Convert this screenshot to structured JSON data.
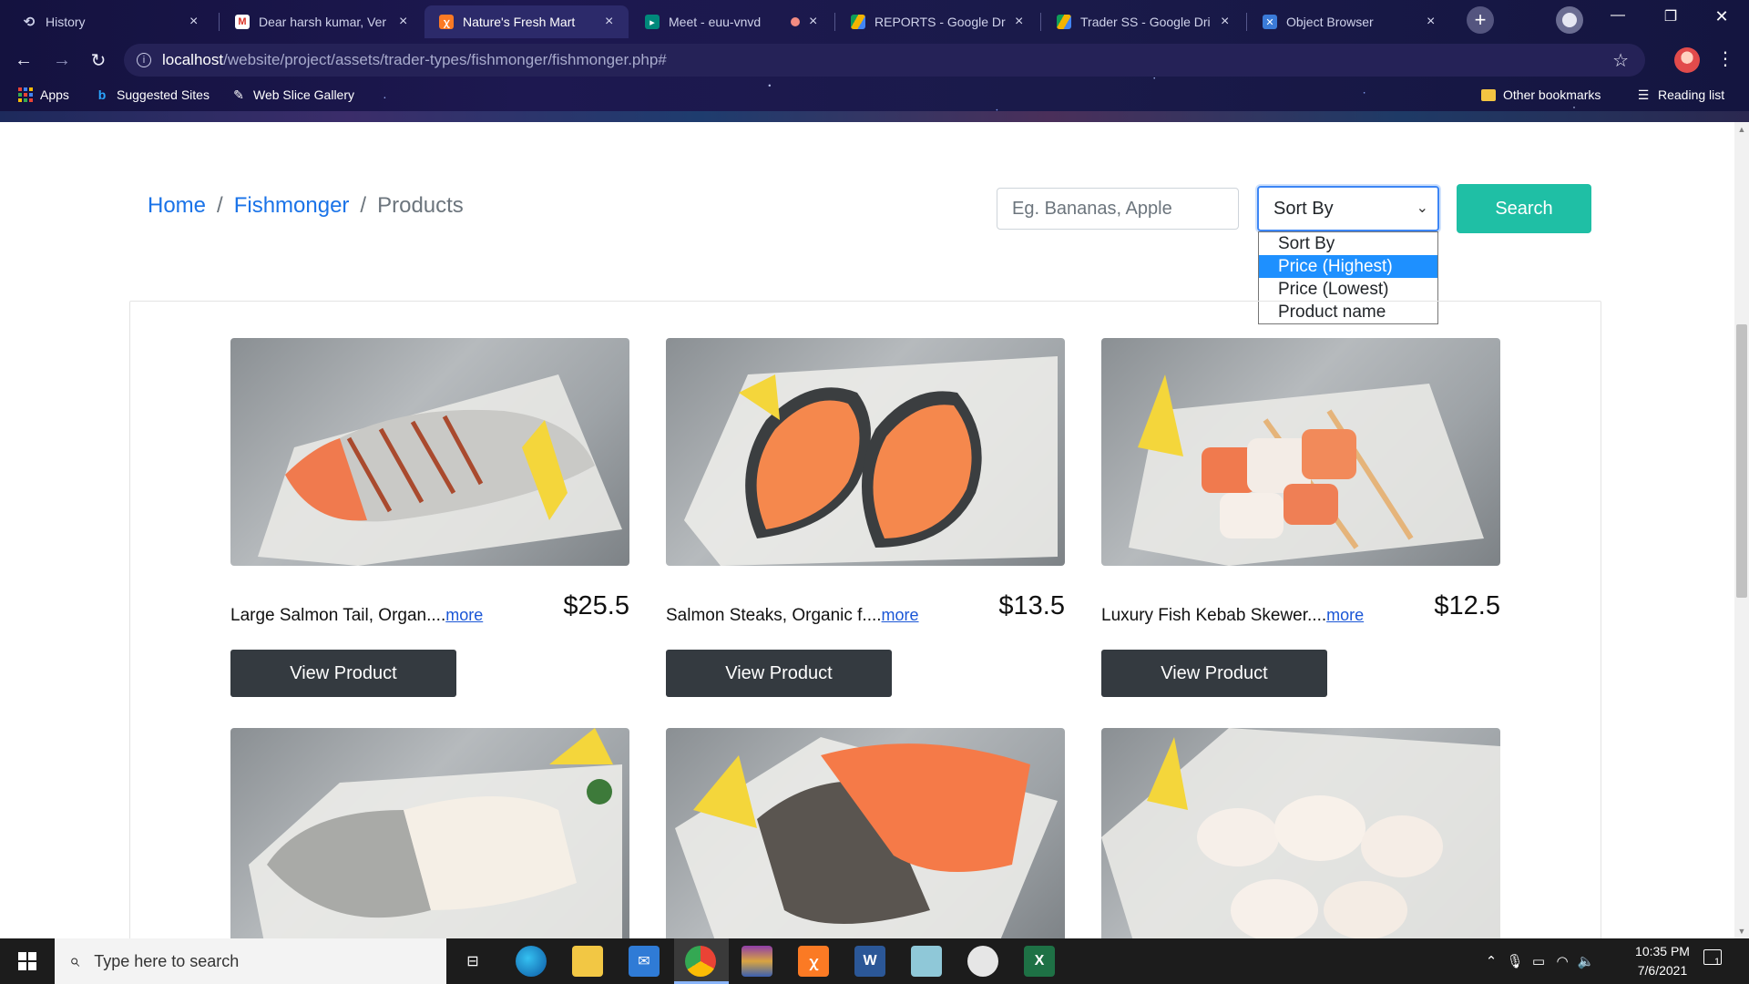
{
  "browser": {
    "tabs": [
      {
        "title": "History",
        "favicon": "history-icon"
      },
      {
        "title": "Dear harsh kumar, Ver",
        "favicon": "gmail-icon"
      },
      {
        "title": "Nature's Fresh Mart",
        "favicon": "xampp-icon"
      },
      {
        "title": "Meet - euu-vnvd",
        "favicon": "google-meet-icon"
      },
      {
        "title": "REPORTS - Google Dri",
        "favicon": "google-drive-icon"
      },
      {
        "title": "Trader SS - Google Dri",
        "favicon": "google-drive-icon"
      },
      {
        "title": "Object Browser",
        "favicon": "object-browser-icon"
      }
    ],
    "url_host": "localhost",
    "url_path": "/website/project/assets/trader-types/fishmonger/fishmonger.php#",
    "bookmarks": {
      "apps": "Apps",
      "suggested": "Suggested Sites",
      "webslice": "Web Slice Gallery",
      "other": "Other bookmarks",
      "reading": "Reading list"
    }
  },
  "breadcrumb": {
    "home": "Home",
    "fishmonger": "Fishmonger",
    "current": "Products",
    "separator": "/"
  },
  "search": {
    "placeholder": "Eg. Bananas, Apple",
    "button": "Search"
  },
  "sort": {
    "selected": "Sort By",
    "options": [
      "Sort By",
      "Price (Highest)",
      "Price (Lowest)",
      "Product name"
    ],
    "highlighted_index": 1
  },
  "products": [
    {
      "name": "Large Salmon Tail, Organ....",
      "more": "more",
      "price": "$25.5",
      "button": "View Product"
    },
    {
      "name": "Salmon Steaks, Organic f....",
      "more": "more",
      "price": "$13.5",
      "button": "View Product"
    },
    {
      "name": "Luxury Fish Kebab Skewer....",
      "more": "more",
      "price": "$12.5",
      "button": "View Product"
    }
  ],
  "taskbar": {
    "search_placeholder": "Type here to search",
    "time": "10:35 PM",
    "date": "7/6/2021",
    "notification_count": "1"
  },
  "colors": {
    "accent_link": "#1a73e8",
    "search_button": "#1fbfa5",
    "view_button": "#343a40",
    "dropdown_highlight": "#1e90ff"
  }
}
